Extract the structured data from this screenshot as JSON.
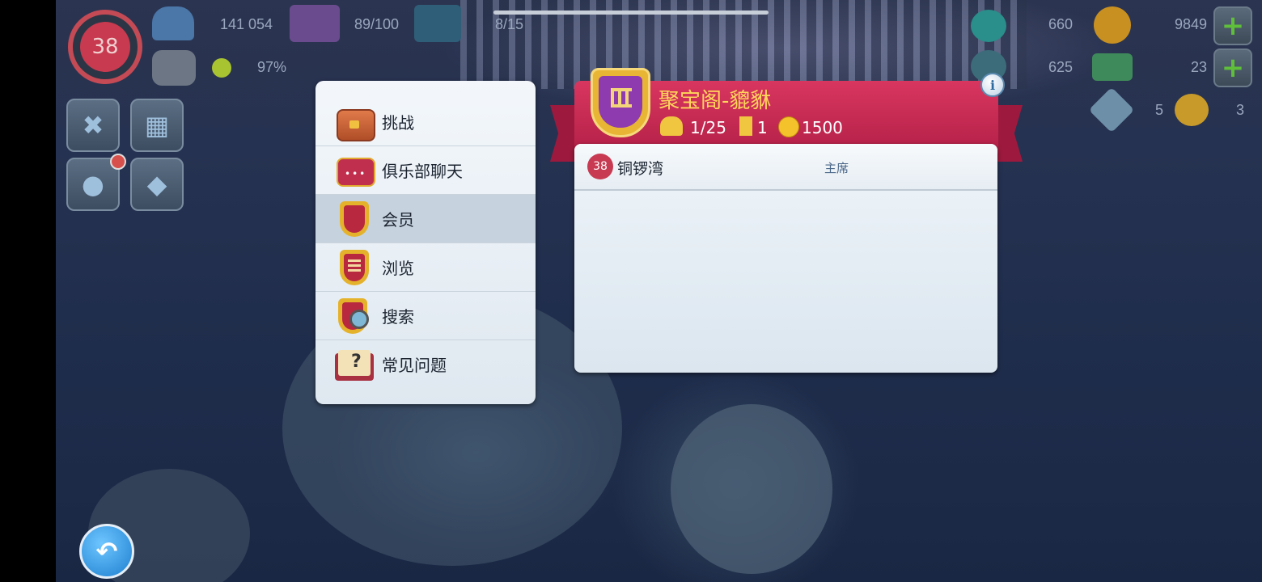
{
  "hud": {
    "level": "38",
    "population": "141 054",
    "storage": "89/100",
    "vehicles": "8/15",
    "happiness": "97%",
    "simoleons_1": "660",
    "simoleons_2": "625",
    "coins": "9849",
    "cash": "23",
    "keys_silver": "5",
    "keys_gold": "3"
  },
  "menu": {
    "items": [
      {
        "label": "挑战",
        "icon": "treasure-chest-icon"
      },
      {
        "label": "俱乐部聊天",
        "icon": "chat-bubble-icon"
      },
      {
        "label": "会员",
        "icon": "club-shield-icon"
      },
      {
        "label": "浏览",
        "icon": "browse-shield-icon"
      },
      {
        "label": "搜索",
        "icon": "search-shield-icon"
      },
      {
        "label": "常见问题",
        "icon": "faq-book-icon"
      }
    ],
    "active_index": 2
  },
  "club": {
    "name": "聚宝阁-貔貅",
    "members": "1/25",
    "towers": "1",
    "points": "1500"
  },
  "members_list": [
    {
      "level": "38",
      "name": "铜锣湾",
      "role": "主席"
    }
  ],
  "colors": {
    "banner": "#c52a52",
    "panel": "#e8f0f6",
    "accent_gold": "#e5b22b"
  }
}
